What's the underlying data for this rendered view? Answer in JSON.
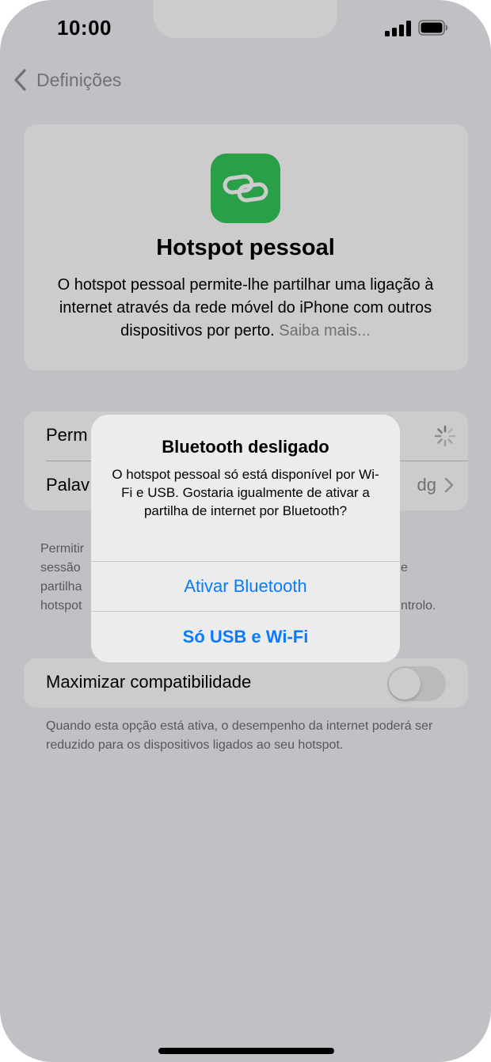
{
  "status_bar": {
    "time": "10:00"
  },
  "nav": {
    "back_label": "Definições"
  },
  "hero": {
    "title": "Hotspot pessoal",
    "description": "O hotspot pessoal permite-lhe partilhar uma ligação à internet através da rede móvel do iPhone com outros dispositivos por perto.",
    "learn_more": "Saiba mais..."
  },
  "settings": {
    "rows": [
      {
        "label": "Perm",
        "value": ""
      },
      {
        "label": "Palav",
        "value": "dg"
      }
    ],
    "footnote": {
      "left_lines": [
        "Permitir",
        "sessão",
        "partilha",
        "hotspot"
      ],
      "right_fragments": [
        "e",
        "ntrolo."
      ]
    }
  },
  "compatibility": {
    "label": "Maximizar compatibilidade",
    "enabled": false,
    "footnote": "Quando esta opção está ativa, o desempenho da internet poderá ser reduzido para os dispositivos ligados ao seu hotspot."
  },
  "alert": {
    "title": "Bluetooth desligado",
    "message": "O hotspot pessoal só está disponível por Wi-Fi e USB. Gostaria igualmente de ativar a partilha de internet por Bluetooth?",
    "buttons": [
      "Ativar Bluetooth",
      "Só USB e Wi-Fi"
    ]
  },
  "colors": {
    "accent": "#0a7aff",
    "app_icon": "#34c759",
    "background": "#f2f2f7"
  }
}
